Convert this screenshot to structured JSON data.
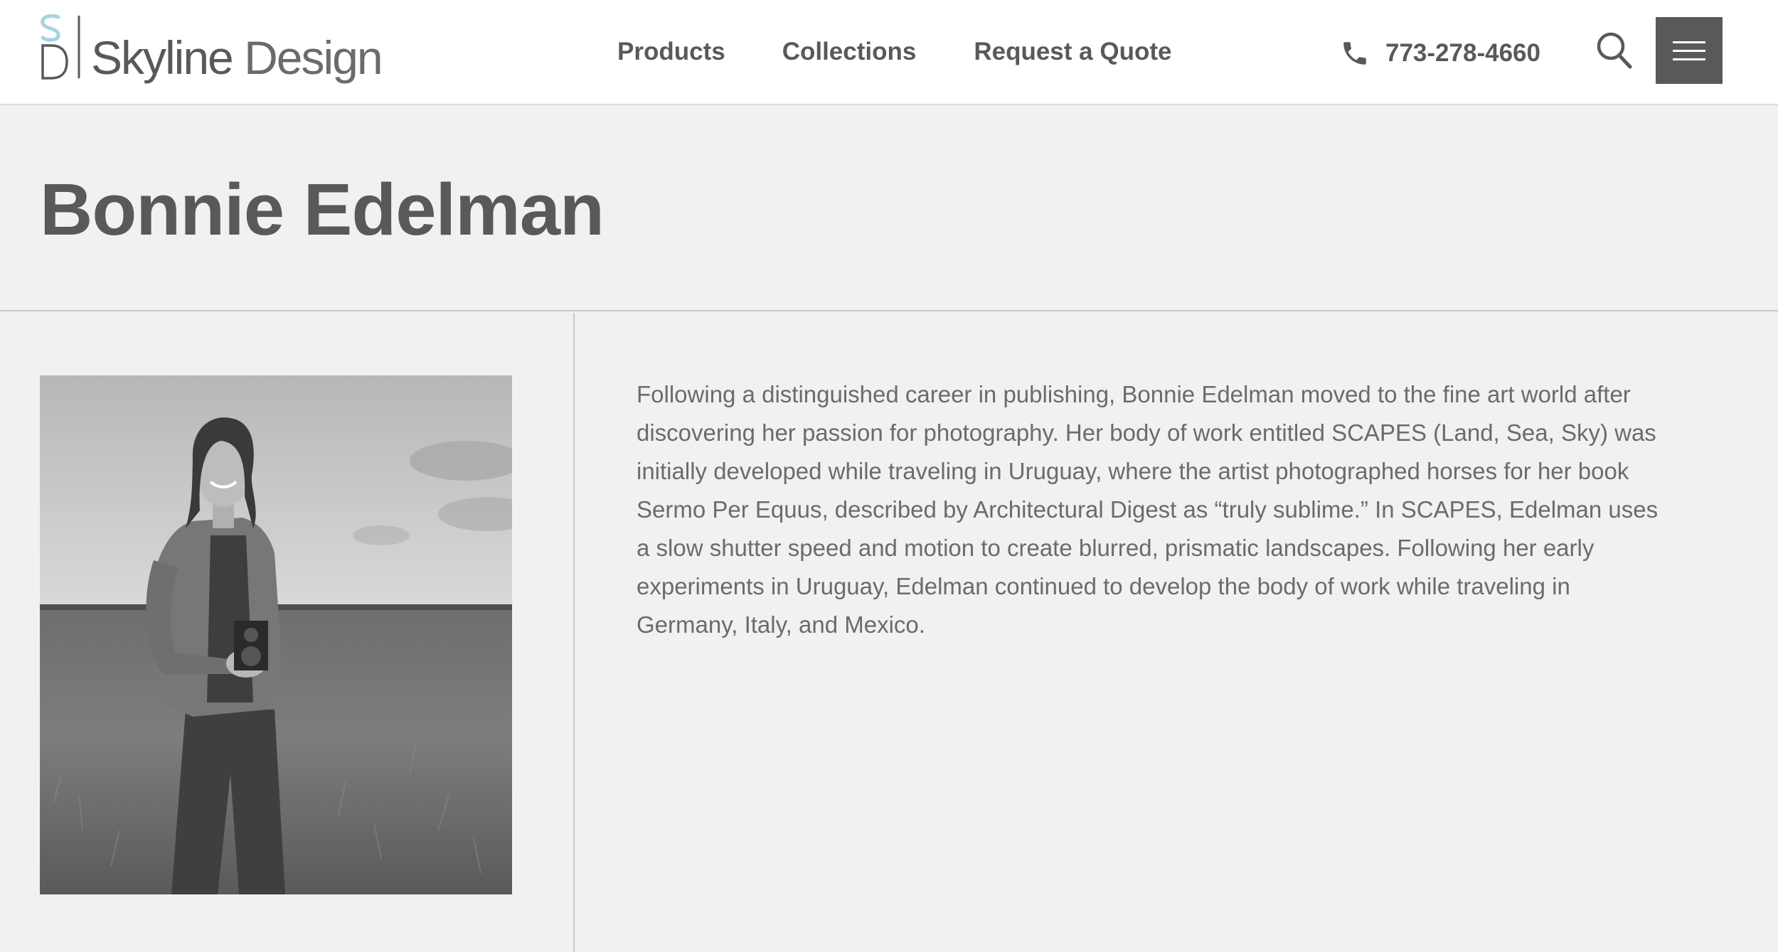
{
  "header": {
    "logo": {
      "mark_letters": "SD",
      "word1": "Skyline",
      "word2": "Design",
      "accent_color": "#a6d4e0"
    },
    "nav": [
      {
        "label": "Products"
      },
      {
        "label": "Collections"
      },
      {
        "label": "Request a Quote"
      }
    ],
    "phone": {
      "number": "773-278-4660",
      "icon": "phone-icon"
    },
    "search_icon": "search-icon",
    "menu_icon": "hamburger-menu-icon"
  },
  "page": {
    "title": "Bonnie Edelman"
  },
  "artist": {
    "photo_alt": "Bonnie Edelman",
    "bio": "Following a distinguished career in publishing, Bonnie Edelman moved to the fine art world after discovering her passion for photography. Her body of work entitled SCAPES (Land, Sea, Sky) was initially developed while traveling in Uruguay, where the artist photographed horses for her book Sermo Per Equus, described by Architectural Digest as “truly sublime.” In SCAPES, Edelman uses a slow shutter speed and motion to create blurred, prismatic landscapes. Following her early experiments in Uruguay, Edelman continued to develop the body of work while traveling in Germany, Italy, and Mexico."
  },
  "colors": {
    "text": "#58595b",
    "background": "#f1f1f1",
    "header_bg": "#ffffff",
    "menu_button_bg": "#58595b"
  }
}
